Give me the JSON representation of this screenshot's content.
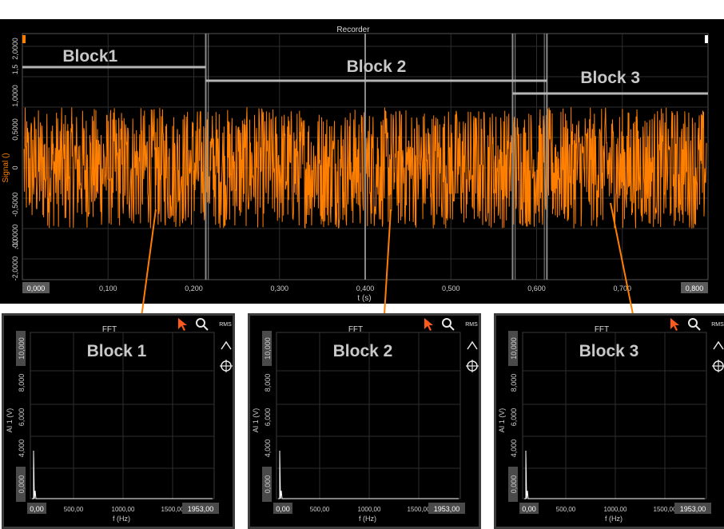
{
  "recorder": {
    "title": "Recorder",
    "ylabel": "Signal ()",
    "xlabel": "t (s)",
    "y_ticks": [
      "2,0000",
      "1,5",
      "1,0000",
      "0,5000",
      "0",
      "-0,5000",
      "-1,0000",
      "-2,0000",
      ",00"
    ],
    "x_ticks": [
      "0,000",
      "0,100",
      "0,200",
      "0,300",
      "0,400",
      "0,500",
      "0,600",
      "0,700",
      "0,800"
    ],
    "signal_color": "#ff7f00",
    "blocks": [
      {
        "label": "Block1"
      },
      {
        "label": "Block 2"
      },
      {
        "label": "Block 3"
      }
    ],
    "block_ranges_s": [
      [
        0.0,
        0.214
      ],
      [
        0.214,
        0.612
      ],
      [
        0.572,
        0.8
      ]
    ],
    "cursor_lines_s": [
      0.214,
      0.4,
      0.572,
      0.612
    ]
  },
  "fft_panels": [
    {
      "title": "FFT",
      "block_label": "Block 1",
      "rms": "RMS",
      "ylabel": "AI 1 (V)",
      "xlabel": "f (Hz)",
      "y_ticks": [
        "10,000",
        "8,000",
        "6,000",
        "4,000",
        "0,000"
      ],
      "x_ticks": [
        "0,00",
        "500,00",
        "1000,00",
        "1500,00",
        "1953,00"
      ]
    },
    {
      "title": "FFT",
      "block_label": "Block 2",
      "rms": "RMS",
      "ylabel": "AI 1 (V)",
      "xlabel": "f (Hz)",
      "y_ticks": [
        "10,000",
        "8,000",
        "6,000",
        "4,000",
        "0,000"
      ],
      "x_ticks": [
        "0,00",
        "500,00",
        "1000,00",
        "1500,00",
        "1953,00"
      ]
    },
    {
      "title": "FFT",
      "block_label": "Block 3",
      "rms": "RMS",
      "ylabel": "AI 1 (V)",
      "xlabel": "f (Hz)",
      "y_ticks": [
        "10,000",
        "8,000",
        "6,000",
        "4,000",
        "0,000"
      ],
      "x_ticks": [
        "0,00",
        "500,00",
        "1000,00",
        "1500,00",
        "1953,00"
      ]
    }
  ],
  "icons": [
    "pointer-icon",
    "zoom-icon",
    "caret-up-icon",
    "crosshair-icon"
  ],
  "accent": "#ff7f00",
  "connector_color": "#ff7f00"
}
